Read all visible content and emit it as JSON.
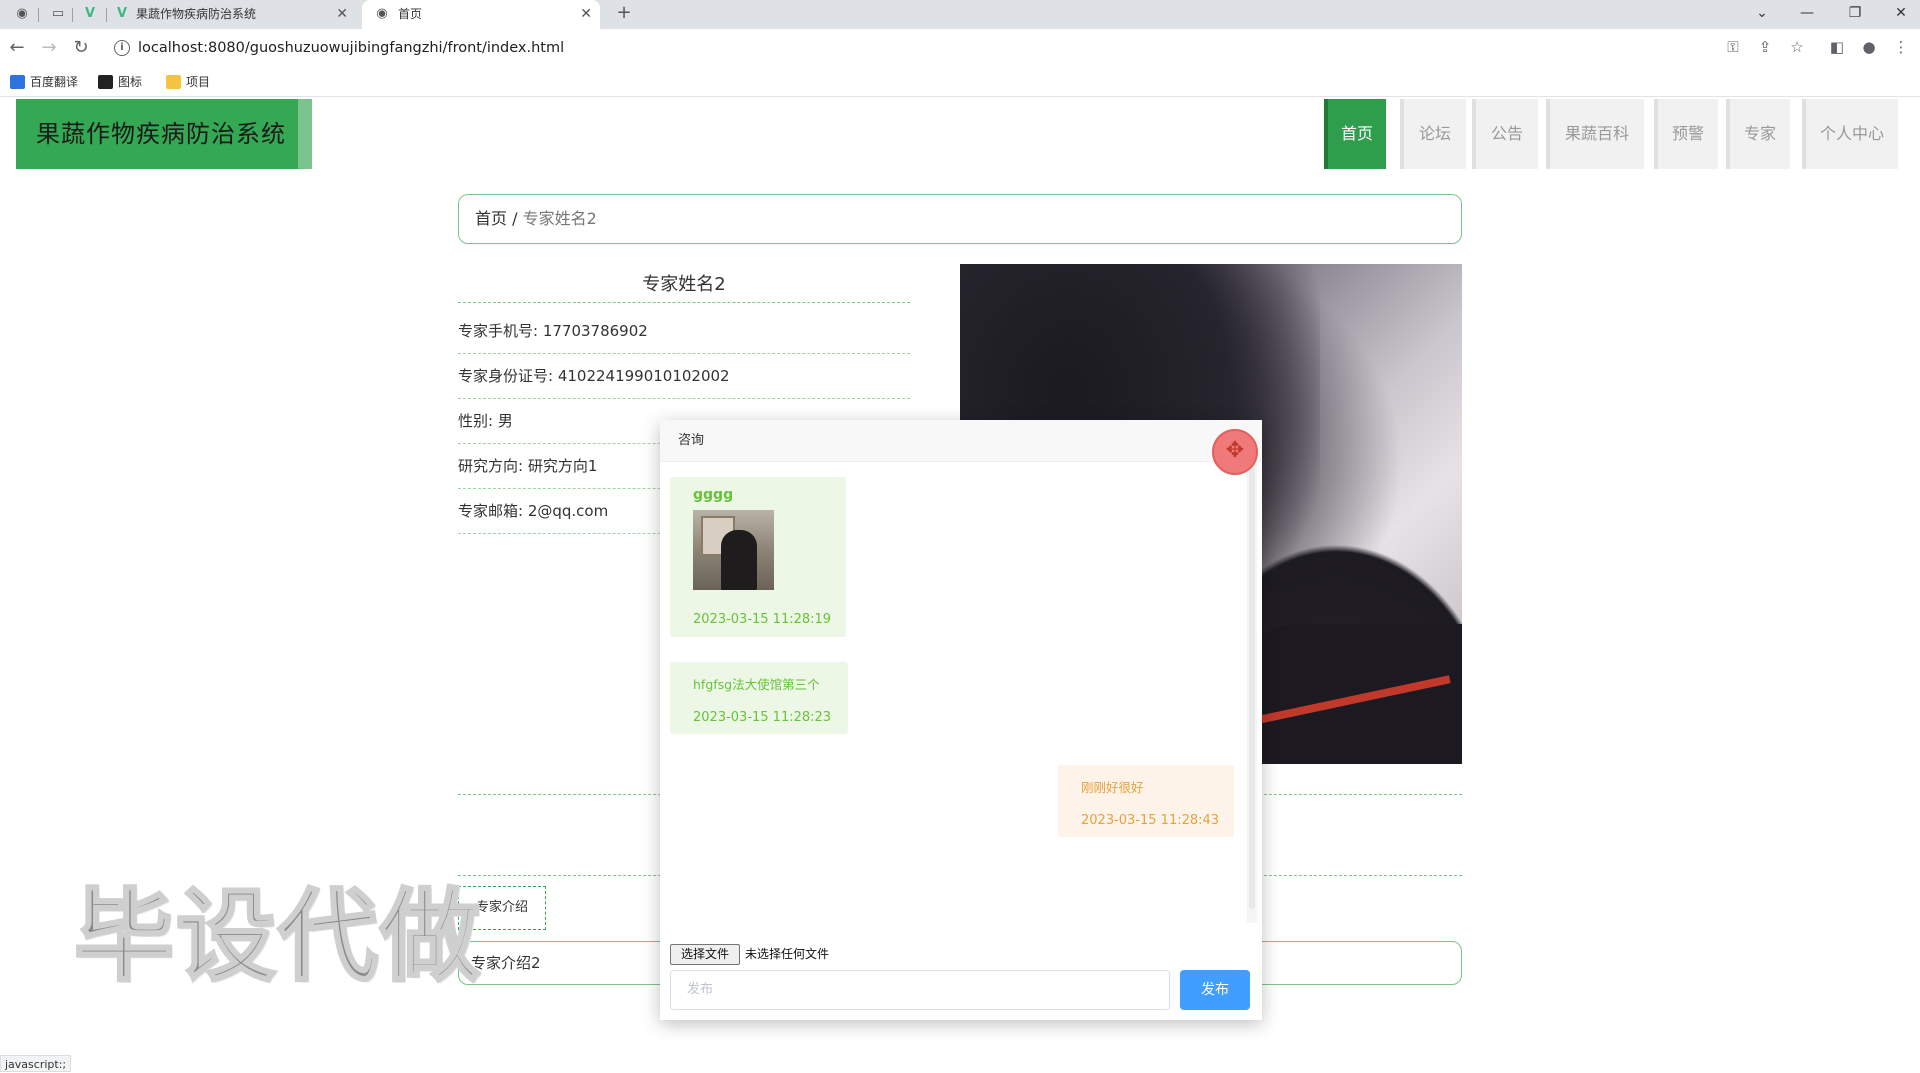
{
  "browser": {
    "tabs": [
      {
        "label": ""
      },
      {
        "label": ""
      },
      {
        "label": "果蔬作物疾病防治系统"
      },
      {
        "label": "首页"
      }
    ],
    "url": "localhost:8080/guoshuzuowujibingfangzhi/front/index.html",
    "bookmarks": [
      "百度翻译",
      "图标",
      "项目"
    ],
    "status": "javascript:;"
  },
  "site": {
    "title": "果蔬作物疾病防治系统",
    "menu": [
      "首页",
      "论坛",
      "公告",
      "果蔬百科",
      "预警",
      "专家",
      "个人中心"
    ]
  },
  "breadcrumb": {
    "home": "首页",
    "sep": "/",
    "current": "专家姓名2"
  },
  "expert": {
    "name": "专家姓名2",
    "rows": [
      "专家手机号: 17703786902",
      "专家身份证号: 410224199010102002",
      "性别: 男",
      "研究方向: 研究方向1",
      "专家邮箱: 2@qq.com"
    ],
    "intro_tab": "专家介绍",
    "intro_text": "专家介绍2"
  },
  "watermark": "毕设代做",
  "dialog": {
    "title": "咨询",
    "close_icon": "move-icon",
    "messages": [
      {
        "side": "left",
        "name": "gggg",
        "has_image": true,
        "time": "2023-03-15 11:28:19"
      },
      {
        "side": "left",
        "text": "hfgfsg法大使馆第三个",
        "time": "2023-03-15 11:28:23"
      },
      {
        "side": "right",
        "text": "刚刚好很好",
        "time": "2023-03-15 11:28:43"
      }
    ],
    "file_button": "选择文件",
    "file_status": "未选择任何文件",
    "input_placeholder": "发布",
    "send_label": "发布"
  },
  "colors": {
    "primary_green": "#34a853",
    "send_blue": "#409eff",
    "left_bubble": "#ecf7e6",
    "right_bubble": "#fdf3e8"
  }
}
